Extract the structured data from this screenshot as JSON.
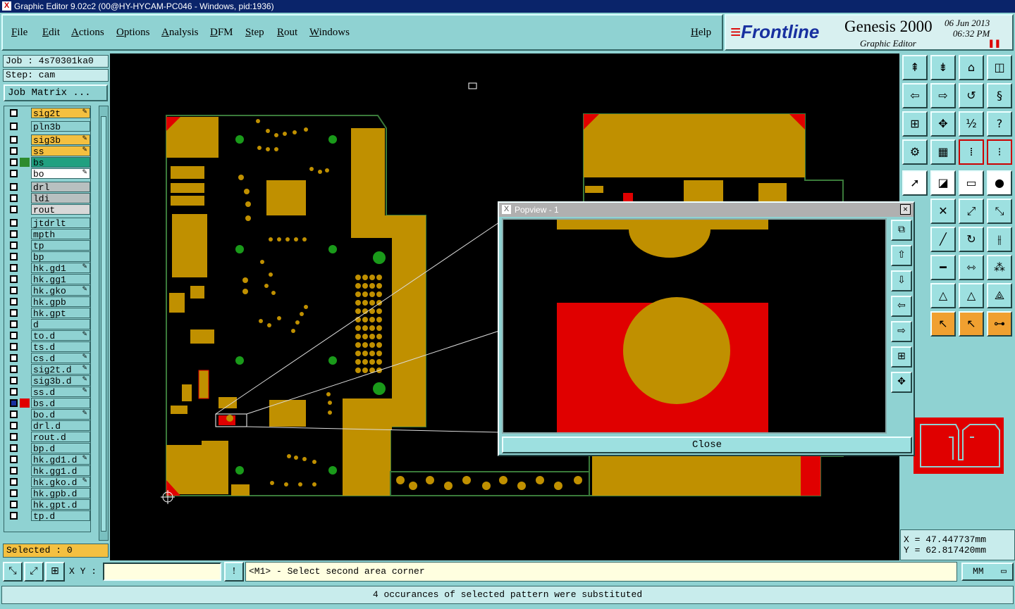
{
  "window": {
    "title": "Graphic Editor 9.02c2 (00@HY-HYCAM-PC046 - Windows, pid:1936)"
  },
  "menu": {
    "items": [
      "File",
      "Edit",
      "Actions",
      "Options",
      "Analysis",
      "DFM",
      "Step",
      "Rout",
      "Windows"
    ],
    "help": "Help"
  },
  "brand": {
    "logo": "Frontline",
    "product": "Genesis 2000",
    "module": "Graphic Editor",
    "date": "06 Jun 2013",
    "time": "06:32 PM"
  },
  "job": {
    "job_line": "Job : 4s70301ka0",
    "step_line": "Step: cam",
    "matrix_button": "Job Matrix ..."
  },
  "layers": [
    {
      "name": "sig2t",
      "color": "#f4c040",
      "edit": true
    },
    {
      "name": "pln3b",
      "color": "#8fd2d2",
      "edit": false,
      "gap": true
    },
    {
      "name": "sig3b",
      "color": "#f4c040",
      "edit": true,
      "gap": true
    },
    {
      "name": "ss",
      "color": "#f4c040",
      "edit": true
    },
    {
      "name": "bs",
      "color": "#20a080",
      "edit": false,
      "swatch": "#2e8b2e"
    },
    {
      "name": "bo",
      "color": "#ffffff",
      "edit": true
    },
    {
      "name": "drl",
      "color": "#b8c0c0",
      "edit": false,
      "gap": true
    },
    {
      "name": "ldi",
      "color": "#b8c0c0",
      "edit": false
    },
    {
      "name": "rout",
      "color": "#d8d8d8",
      "edit": false
    },
    {
      "name": "jtdrlt",
      "color": "#8fd2d2",
      "edit": false,
      "gap": true
    },
    {
      "name": "mpth",
      "color": "#8fd2d2",
      "edit": false
    },
    {
      "name": "tp",
      "color": "#8fd2d2",
      "edit": false
    },
    {
      "name": "bp",
      "color": "#8fd2d2",
      "edit": false
    },
    {
      "name": "hk.gd1",
      "color": "#8fd2d2",
      "edit": true
    },
    {
      "name": "hk.gg1",
      "color": "#8fd2d2",
      "edit": false
    },
    {
      "name": "hk.gko",
      "color": "#8fd2d2",
      "edit": true
    },
    {
      "name": "hk.gpb",
      "color": "#8fd2d2",
      "edit": false
    },
    {
      "name": "hk.gpt",
      "color": "#8fd2d2",
      "edit": false
    },
    {
      "name": "d",
      "color": "#8fd2d2",
      "edit": false
    },
    {
      "name": "to.d",
      "color": "#8fd2d2",
      "edit": true
    },
    {
      "name": "ts.d",
      "color": "#8fd2d2",
      "edit": false
    },
    {
      "name": "cs.d",
      "color": "#8fd2d2",
      "edit": true
    },
    {
      "name": "sig2t.d",
      "color": "#8fd2d2",
      "edit": true
    },
    {
      "name": "sig3b.d",
      "color": "#8fd2d2",
      "edit": true
    },
    {
      "name": "ss.d",
      "color": "#8fd2d2",
      "edit": true
    },
    {
      "name": "bs.d",
      "color": "#8fd2d2",
      "edit": false,
      "swatch": "#e00000",
      "active": true
    },
    {
      "name": "bo.d",
      "color": "#8fd2d2",
      "edit": true
    },
    {
      "name": "drl.d",
      "color": "#8fd2d2",
      "edit": false
    },
    {
      "name": "rout.d",
      "color": "#8fd2d2",
      "edit": false
    },
    {
      "name": "bp.d",
      "color": "#8fd2d2",
      "edit": false
    },
    {
      "name": "hk.gd1.d",
      "color": "#8fd2d2",
      "edit": true
    },
    {
      "name": "hk.gg1.d",
      "color": "#8fd2d2",
      "edit": false
    },
    {
      "name": "hk.gko.d",
      "color": "#8fd2d2",
      "edit": true
    },
    {
      "name": "hk.gpb.d",
      "color": "#8fd2d2",
      "edit": false
    },
    {
      "name": "hk.gpt.d",
      "color": "#8fd2d2",
      "edit": false
    },
    {
      "name": "tp.d",
      "color": "#8fd2d2",
      "edit": false
    }
  ],
  "selected": "Selected : 0",
  "popview": {
    "title": "Popview - 1",
    "close_label": "Close"
  },
  "coords": {
    "x_line": "X  =  47.447737mm",
    "y_line": "Y  =  62.817420mm"
  },
  "bottom": {
    "xy_label": "X Y :",
    "xy_value": "",
    "prompt": "<M1> - Select second area corner",
    "units": "MM"
  },
  "status": "4 occurances of selected pattern were substituted",
  "colors": {
    "copper": "#c09000",
    "mask": "#e00000",
    "pad_green": "#1a9a1a",
    "outline": "#3a7a3a",
    "panel": "#8fd2d2"
  }
}
